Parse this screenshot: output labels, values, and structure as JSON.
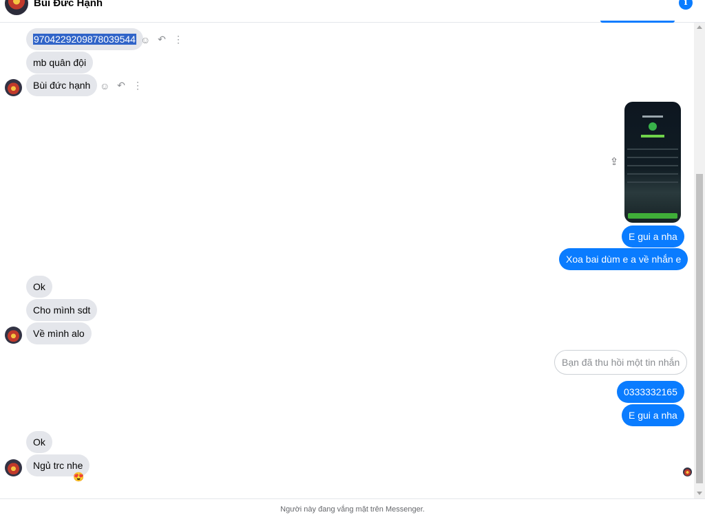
{
  "conversation": {
    "contact_name": "Bùi Đức Hạnh",
    "info_icon": "i"
  },
  "messages": {
    "m1": "9704229209878039544",
    "m2": "mb quân đội",
    "m3": "Bùi đức hạnh",
    "m4": "E gui a nha",
    "m5": "Xoa bai dùm e a về nhắn e",
    "m6": "Ok",
    "m7": "Cho mình sdt",
    "m8": "Về mình alo",
    "m9": "Bạn đã thu hồi một tin nhắn",
    "m10": "0333332165",
    "m11": "E gui a nha",
    "m12": "Ok",
    "m13": "Ngủ trc nhe",
    "reaction_13": "😍"
  },
  "icons": {
    "react": "smiley-icon",
    "reply": "reply-icon",
    "more": "more-vertical-icon",
    "share": "share-icon"
  },
  "footer": {
    "status_text": "Người này đang vắng mặt trên Messenger."
  },
  "colors": {
    "outgoing": "#0a7cff",
    "incoming": "#e4e6eb"
  }
}
